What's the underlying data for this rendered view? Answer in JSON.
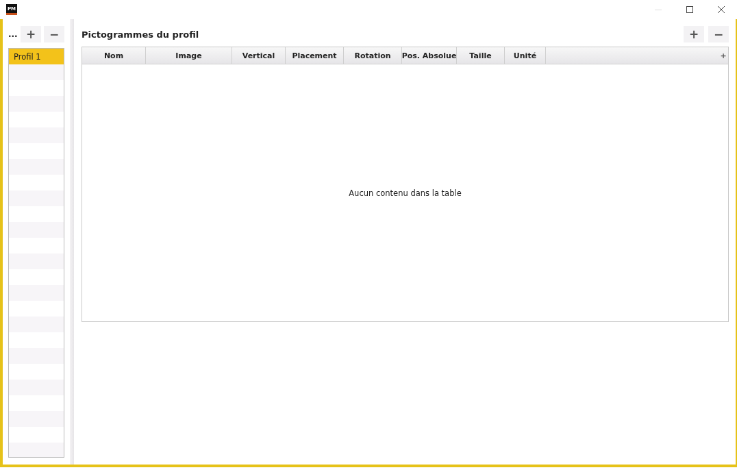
{
  "window": {
    "app_logo": "PM"
  },
  "left_panel": {
    "label": "...",
    "add_button": "+",
    "remove_button": "−",
    "profiles": [
      {
        "name": "Profil 1",
        "selected": true
      }
    ]
  },
  "main_panel": {
    "title": "Pictogrammes du profil",
    "add_button": "+",
    "remove_button": "−",
    "table": {
      "columns": [
        "Nom",
        "Image",
        "Vertical",
        "Placement",
        "Rotation",
        "Pos. Absolue",
        "Taille",
        "Unité"
      ],
      "column_menu_button": "+",
      "placeholder": "Aucun contenu dans la table"
    }
  }
}
